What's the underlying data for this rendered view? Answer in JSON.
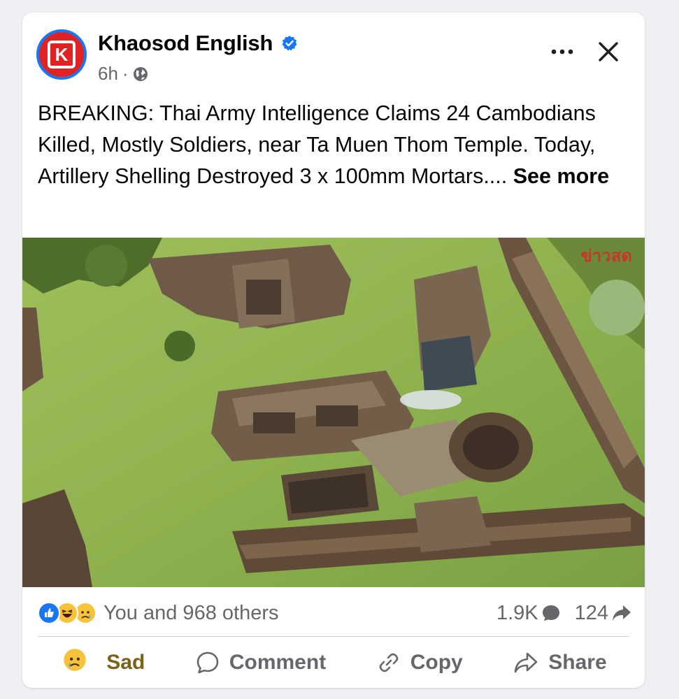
{
  "post": {
    "page_name": "Khaosod English",
    "avatar_letter": "K",
    "time": "6h",
    "separator": "·",
    "text": "BREAKING: Thai Army Intelligence Claims 24 Cambodians Killed, Mostly Soldiers, near Ta Muen Thom Temple. Today, Artillery Shelling Destroyed 3 x 100mm Mortars.... ",
    "see_more": "See more"
  },
  "image": {
    "watermark": "ข่าวสด",
    "description_icon": "aerial-temple-photo"
  },
  "reactions": {
    "icons": [
      "like-reaction-icon",
      "haha-reaction-icon",
      "sad-reaction-icon"
    ],
    "summary": "You and 968 others",
    "comments": "1.9K",
    "shares": "124"
  },
  "actions": {
    "sad": "Sad",
    "comment": "Comment",
    "copy": "Copy",
    "share": "Share"
  },
  "colors": {
    "brand_blue": "#1877f2",
    "avatar_red": "#e02222",
    "secondary_text": "#65676b",
    "sad_gold": "#7a6216"
  }
}
